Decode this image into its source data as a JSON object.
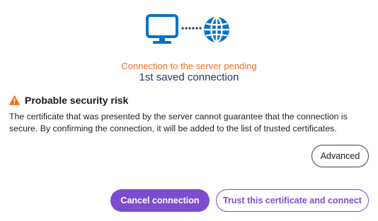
{
  "hero": {
    "monitor_icon": "monitor-icon",
    "connector": "dotted-connector",
    "globe_icon": "globe-icon",
    "icon_color": "#0a72c4"
  },
  "status": {
    "text": "Connection to the server pending",
    "color": "#f36c21"
  },
  "connection": {
    "name": "1st saved connection"
  },
  "warning": {
    "icon": "warning-triangle-icon",
    "icon_color": "#f36c21",
    "title": "Probable security risk",
    "body": "The certificate that was presented by the server cannot guarantee that the connection is secure. By confirming the connection, it will be added to the list of trusted certificates."
  },
  "buttons": {
    "advanced": "Advanced",
    "cancel": "Cancel connection",
    "trust": "Trust this certificate and connect",
    "accent": "#7c4dd0"
  }
}
